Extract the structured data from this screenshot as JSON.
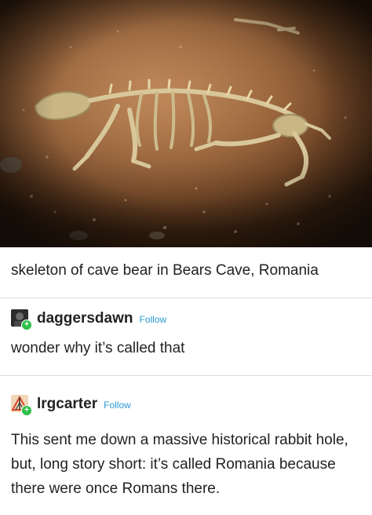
{
  "photo": {
    "icon": "cave-bear-skeleton-image"
  },
  "caption": "skeleton of cave bear in Bears Cave, Romania",
  "posts": [
    {
      "username": "daggersdawn",
      "follow_label": "Follow",
      "text": "wonder why it’s called that"
    },
    {
      "username": "lrgcarter",
      "follow_label": "Follow",
      "text": "This sent me down a massive historical rabbit hole, but, long story short: it’s called Romania because there were once Romans there."
    }
  ],
  "colors": {
    "follow": "#2a9bd6",
    "badge": "#2fbf48",
    "divider": "#dcdcdc"
  }
}
